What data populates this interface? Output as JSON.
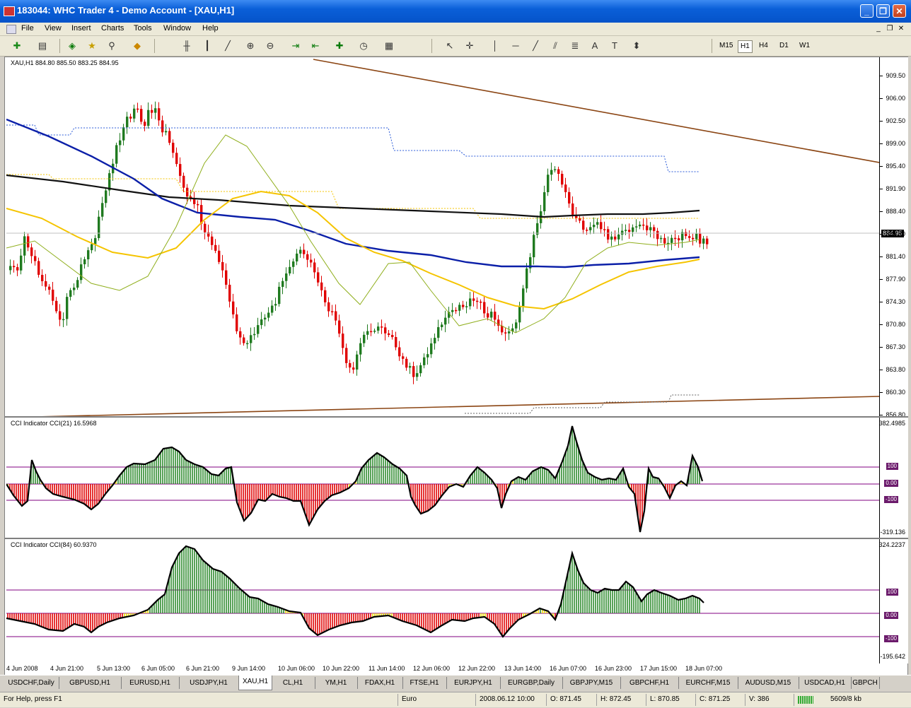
{
  "window": {
    "title": "183044: WHC Trader 4 - Demo Account - [XAU,H1]",
    "minimize_label": "_",
    "restore_label": "❐",
    "close_label": "✕"
  },
  "menu": {
    "items": [
      "File",
      "View",
      "Insert",
      "Charts",
      "Tools",
      "Window",
      "Help"
    ],
    "mdi": [
      "_",
      "❐",
      "✕"
    ]
  },
  "toolbar": {
    "timeframes": [
      "M15",
      "H1",
      "H4",
      "D1",
      "W1"
    ],
    "selected_timeframe": "H1",
    "tool_glyphs": [
      "A",
      "T"
    ]
  },
  "chart": {
    "header": "XAU,H1  884.80 885.50 883.25 884.95",
    "current_price": "884.95",
    "price_ticks": [
      "909.50",
      "906.00",
      "902.50",
      "899.00",
      "895.40",
      "891.90",
      "888.40",
      "884.90",
      "881.40",
      "877.90",
      "874.30",
      "870.80",
      "867.30",
      "863.80",
      "860.30",
      "856.80"
    ],
    "cci21": {
      "label": "CCI Indicator  CCI(21) 16.5968",
      "max": "382.4985",
      "min": "-319.136",
      "levels": [
        "100",
        "0.00",
        "-100"
      ]
    },
    "cci84": {
      "label": "CCI Indicator  CCI(84) 60.9370",
      "max": "324.2237",
      "min": "-195.642",
      "levels": [
        "100",
        "0.00",
        "-100"
      ]
    },
    "time_labels": [
      "4 Jun 2008",
      "4 Jun 21:00",
      "5 Jun 13:00",
      "6 Jun 05:00",
      "6 Jun 21:00",
      "9 Jun 14:00",
      "10 Jun 06:00",
      "10 Jun 22:00",
      "11 Jun 14:00",
      "12 Jun 06:00",
      "12 Jun 22:00",
      "13 Jun 14:00",
      "16 Jun 07:00",
      "16 Jun 23:00",
      "17 Jun 15:00",
      "18 Jun 07:00"
    ],
    "colors": {
      "bull": "#1f7a1f",
      "bear": "#e00000",
      "ma_blue": "#0b1fa8",
      "ma_black": "#111111",
      "ma_yellow": "#f5c400",
      "ma_thin": "#8fae1b",
      "trendline": "#8b4513",
      "level": "#800080"
    }
  },
  "tabs": [
    "USDCHF,Daily",
    "GBPUSD,H1",
    "EURUSD,H1",
    "USDJPY,H1",
    "XAU,H1",
    "CL,H1",
    "YM,H1",
    "FDAX,H1",
    "FTSE,H1",
    "EURJPY,H1",
    "EURGBP,Daily",
    "GBPJPY,M15",
    "GBPCHF,H1",
    "EURCHF,M15",
    "AUDUSD,M15",
    "USDCAD,H1",
    "GBPCH"
  ],
  "active_tab": "XAU,H1",
  "status": {
    "help": "For Help, press F1",
    "profile": "Euro",
    "datetime": "2008.06.12 10:00",
    "open": "O: 871.45",
    "high": "H: 872.45",
    "low": "L: 870.85",
    "close": "C: 871.25",
    "volume": "V: 386",
    "traffic": "5609/8 kb"
  }
}
